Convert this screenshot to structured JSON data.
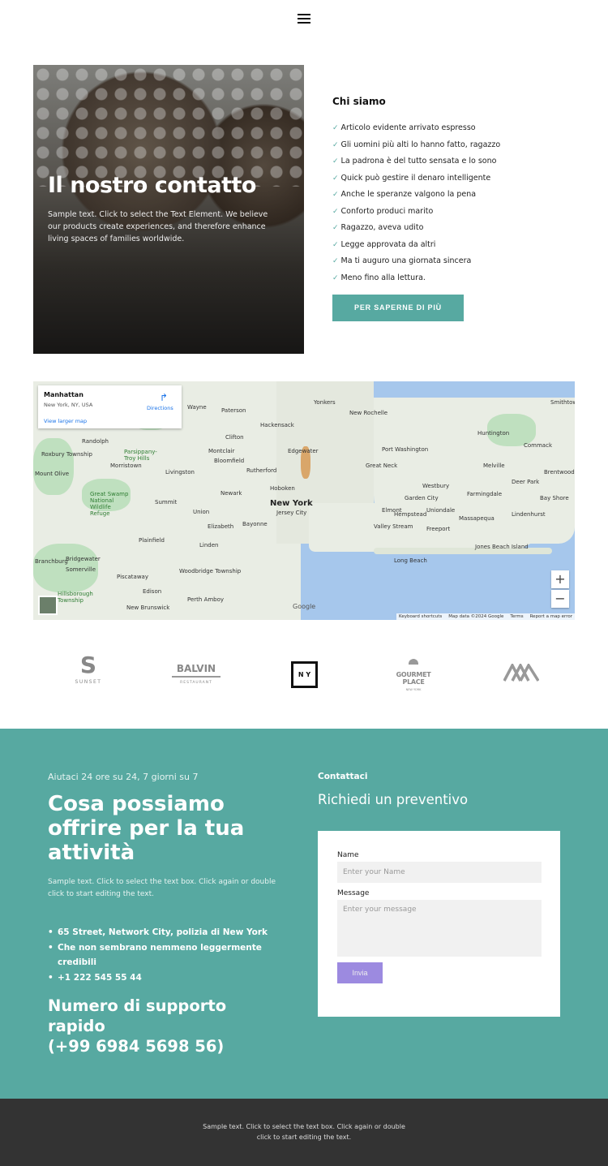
{
  "header": {
    "menu_icon": "hamburger-icon"
  },
  "hero": {
    "title": "Il nostro contatto",
    "text": "Sample text. Click to select the Text Element. We believe our products create experiences, and therefore enhance living spaces of families worldwide."
  },
  "about": {
    "title": "Chi siamo",
    "items": [
      "Articolo evidente arrivato espresso",
      "Gli uomini più alti lo hanno fatto, ragazzo",
      "La padrona è del tutto sensata e lo sono",
      "Quick può gestire il denaro intelligente",
      "Anche le speranze valgono la pena",
      "Conforto produci marito",
      "Ragazzo, aveva udito",
      "Legge approvata da altri",
      "Ma ti auguro una giornata sincera",
      "Meno fino alla lettura."
    ],
    "check_icon": "✓",
    "button": "PER SAPERNE DI PIÙ"
  },
  "map": {
    "place": "Manhattan",
    "address": "New York, NY, USA",
    "directions": "Directions",
    "larger": "View larger map",
    "labels": [
      "New York",
      "Newark",
      "Yonkers",
      "Hoboken",
      "Jersey City",
      "Paterson",
      "Hackensack",
      "New Rochelle",
      "Port Washington",
      "Great Neck",
      "Huntington",
      "Commack",
      "Smithtown",
      "Melville",
      "Deer Park",
      "Brentwood",
      "Bay Shore",
      "Farmingdale",
      "Westbury",
      "Garden City",
      "Uniondale",
      "Hempstead",
      "Elmont",
      "Valley Stream",
      "Freeport",
      "Massapequa",
      "Lindenhurst",
      "Long Beach",
      "Jones Beach Island",
      "Elizabeth",
      "Bayonne",
      "Union",
      "Linden",
      "Plainfield",
      "Edison",
      "Perth Amboy",
      "Woodbridge Township",
      "Piscataway",
      "New Brunswick",
      "Somerville",
      "Bridgewater",
      "Branchburg",
      "Hillsborough Township",
      "Morristown",
      "Livingston",
      "Montclair",
      "Bloomfield",
      "Clifton",
      "Wayne",
      "Randolph",
      "Summit",
      "Great Swamp National Wildlife Refuge",
      "Edgewater",
      "Rutherford",
      "Parsippany-Troy Hills",
      "Roxbury Township",
      "Mount Olive"
    ],
    "zoom_in": "+",
    "zoom_out": "−",
    "google": "Google",
    "attribution": [
      "Keyboard shortcuts",
      "Map data ©2024 Google",
      "Terms",
      "Report a map error"
    ]
  },
  "logos": [
    {
      "main": "S",
      "sub": "SUNSET"
    },
    {
      "main": "BALVIN",
      "sub": "RESTAURANT"
    },
    {
      "main": "N Y"
    },
    {
      "main": "GOURMET PLACE",
      "sub": "NEW YORK"
    },
    {
      "main": "mountain-logo"
    }
  ],
  "contact": {
    "help": "Aiutaci 24 ore su 24, 7 giorni su 7",
    "title": "Cosa possiamo offrire per la tua attività",
    "text": "Sample text. Click to select the text box. Click again or double click to start editing the text.",
    "bullets": [
      "65 Street, Network City, polizia di New York",
      "Che non sembrano nemmeno leggermente credibili",
      "+1 222 545 55 44"
    ],
    "support": "Numero di supporto rapido\n(+99 6984 5698 56)",
    "support_line1": "Numero di supporto rapido",
    "support_line2": "(+99 6984 5698 56)",
    "form_heading": "Contattaci",
    "form_subheading": "Richiedi un preventivo",
    "name_label": "Name",
    "name_placeholder": "Enter your Name",
    "message_label": "Message",
    "message_placeholder": "Enter your message",
    "submit": "Invia"
  },
  "colors": {
    "accent": "#57a9a1",
    "submit": "#9c8ae0",
    "footer": "#333333"
  },
  "footer": {
    "text": "Sample text. Click to select the text box. Click again or double click to start editing the text."
  }
}
